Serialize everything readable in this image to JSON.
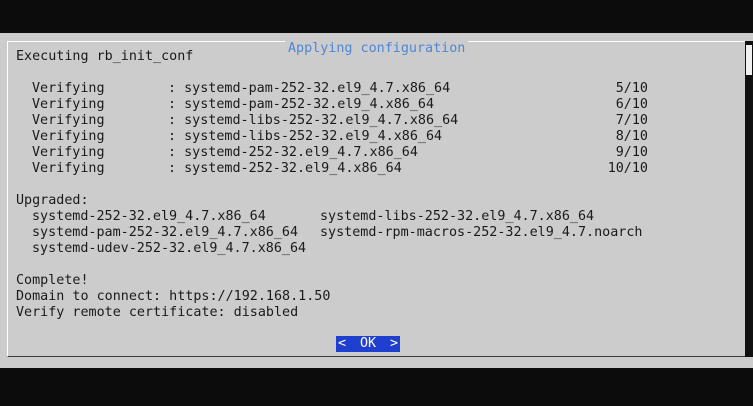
{
  "dialog": {
    "title": "Applying configuration",
    "header_line": "Executing rb_init_conf"
  },
  "verifying": [
    {
      "action": "Verifying",
      "package": ": systemd-pam-252-32.el9_4.7.x86_64",
      "count": "5/10"
    },
    {
      "action": "Verifying",
      "package": ": systemd-pam-252-32.el9_4.x86_64",
      "count": "6/10"
    },
    {
      "action": "Verifying",
      "package": ": systemd-libs-252-32.el9_4.7.x86_64",
      "count": "7/10"
    },
    {
      "action": "Verifying",
      "package": ": systemd-libs-252-32.el9_4.x86_64",
      "count": "8/10"
    },
    {
      "action": "Verifying",
      "package": ": systemd-252-32.el9_4.7.x86_64",
      "count": "9/10"
    },
    {
      "action": "Verifying",
      "package": ": systemd-252-32.el9_4.x86_64",
      "count": "10/10"
    }
  ],
  "upgraded": {
    "heading": "Upgraded:",
    "col1": [
      "systemd-252-32.el9_4.7.x86_64",
      "systemd-pam-252-32.el9_4.7.x86_64",
      "systemd-udev-252-32.el9_4.7.x86_64"
    ],
    "col2": [
      "systemd-libs-252-32.el9_4.7.x86_64",
      "systemd-rpm-macros-252-32.el9_4.7.noarch"
    ]
  },
  "result": {
    "complete": "Complete!",
    "domain_line": "Domain to connect: https://192.168.1.50",
    "cert_line": "Verify remote certificate: disabled"
  },
  "buttons": {
    "ok_left": "<",
    "ok_label": "OK",
    "ok_right": ">"
  }
}
